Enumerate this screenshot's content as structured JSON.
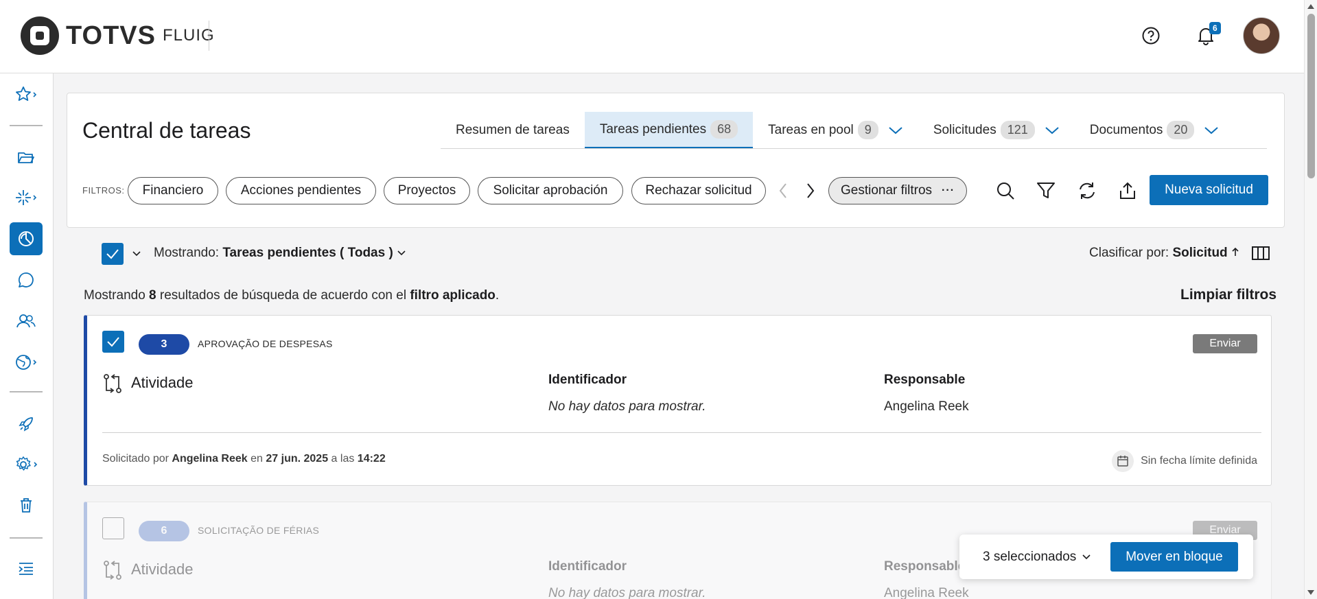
{
  "header": {
    "logo_text": "TOTVS",
    "logo_sub": "FLUIG",
    "notification_count": "6"
  },
  "panel": {
    "title": "Central de tareas",
    "tabs": [
      {
        "label": "Resumen de tareas",
        "count": ""
      },
      {
        "label": "Tareas pendientes",
        "count": "68"
      },
      {
        "label": "Tareas en pool",
        "count": "9"
      },
      {
        "label": "Solicitudes",
        "count": "121"
      },
      {
        "label": "Documentos",
        "count": "20"
      }
    ],
    "filters_label": "FILTROS:",
    "chips": [
      "Financiero",
      "Acciones pendientes",
      "Proyectos",
      "Solicitar aprobación",
      "Rechazar solicitud"
    ],
    "manage_filters": "Gestionar filtros",
    "new_request": "Nueva solicitud"
  },
  "list": {
    "showing_label": "Mostrando:",
    "showing_value": "Tareas pendientes ( Todas )",
    "sort_label": "Clasificar por:",
    "sort_value": "Solicitud",
    "results_pre": "Mostrando ",
    "results_count": "8",
    "results_mid": " resultados de búsqueda de acuerdo con el ",
    "results_bold": "filtro aplicado",
    "results_end": ".",
    "clear_filters": "Limpiar filtros"
  },
  "cards": [
    {
      "id": "3",
      "process": "APROVAÇÃO DE DESPESAS",
      "send": "Enviar",
      "activity": "Atividade",
      "identifier_label": "Identificador",
      "identifier_value": "No hay datos para mostrar.",
      "responsible_label": "Responsable",
      "responsible_value": "Angelina Reek",
      "req_by": "Solicitado por",
      "req_user": "Angelina Reek",
      "req_on": "en",
      "req_date": "27 jun. 2025",
      "req_at": "a las",
      "req_time": "14:22",
      "deadline": "Sin fecha límite definida"
    },
    {
      "id": "6",
      "process": "SOLICITAÇÃO DE FÉRIAS",
      "send": "Enviar",
      "activity": "Atividade",
      "identifier_label": "Identificador",
      "identifier_value": "No hay datos para mostrar.",
      "responsible_label": "Responsable",
      "responsible_value": "Angelina Reek"
    }
  ],
  "bulk": {
    "selected": "3 seleccionados",
    "move": "Mover en bloque"
  },
  "colors": {
    "primary": "#0c6fb8",
    "card_accent": "#1e4aa6",
    "tab_active_bg": "#ddebf7"
  }
}
